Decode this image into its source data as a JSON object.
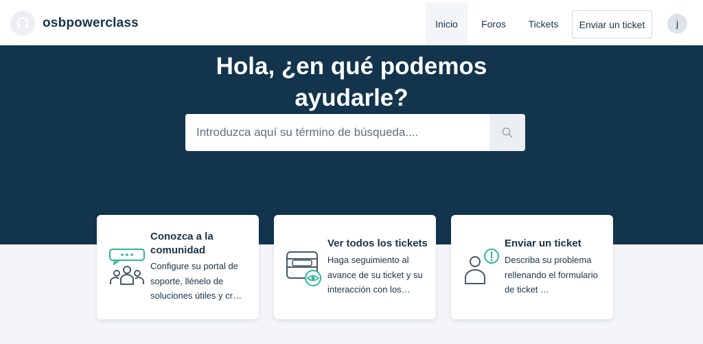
{
  "header": {
    "brand": "osbpowerclass",
    "logo_icon": "headset-icon",
    "nav": [
      {
        "label": "Inicio",
        "active": true
      },
      {
        "label": "Foros",
        "active": false
      },
      {
        "label": "Tickets",
        "active": false
      }
    ],
    "submit_button": "Enviar un ticket",
    "avatar_initial": "j"
  },
  "hero": {
    "title": "Hola, ¿en qué podemos ayudarle?",
    "search_placeholder": "Introduzca aquí su término de búsqueda....",
    "search_icon": "search-icon"
  },
  "cards": [
    {
      "title": "Conozca a la comunidad",
      "description": "Configure su portal de soporte, llénelo de soluciones útiles y cr…",
      "icon": "community-icon"
    },
    {
      "title": "Ver todos los tickets",
      "description": "Haga seguimiento al avance de su ticket y su interacción con los…",
      "icon": "view-tickets-icon"
    },
    {
      "title": "Enviar un ticket",
      "description": "Describa su problema rellenando el formulario de ticket …",
      "icon": "submit-ticket-icon"
    }
  ],
  "colors": {
    "hero_bg": "#12344d",
    "accent": "#2bb59a",
    "text": "#183247",
    "page_bg": "#f3f5f8"
  }
}
